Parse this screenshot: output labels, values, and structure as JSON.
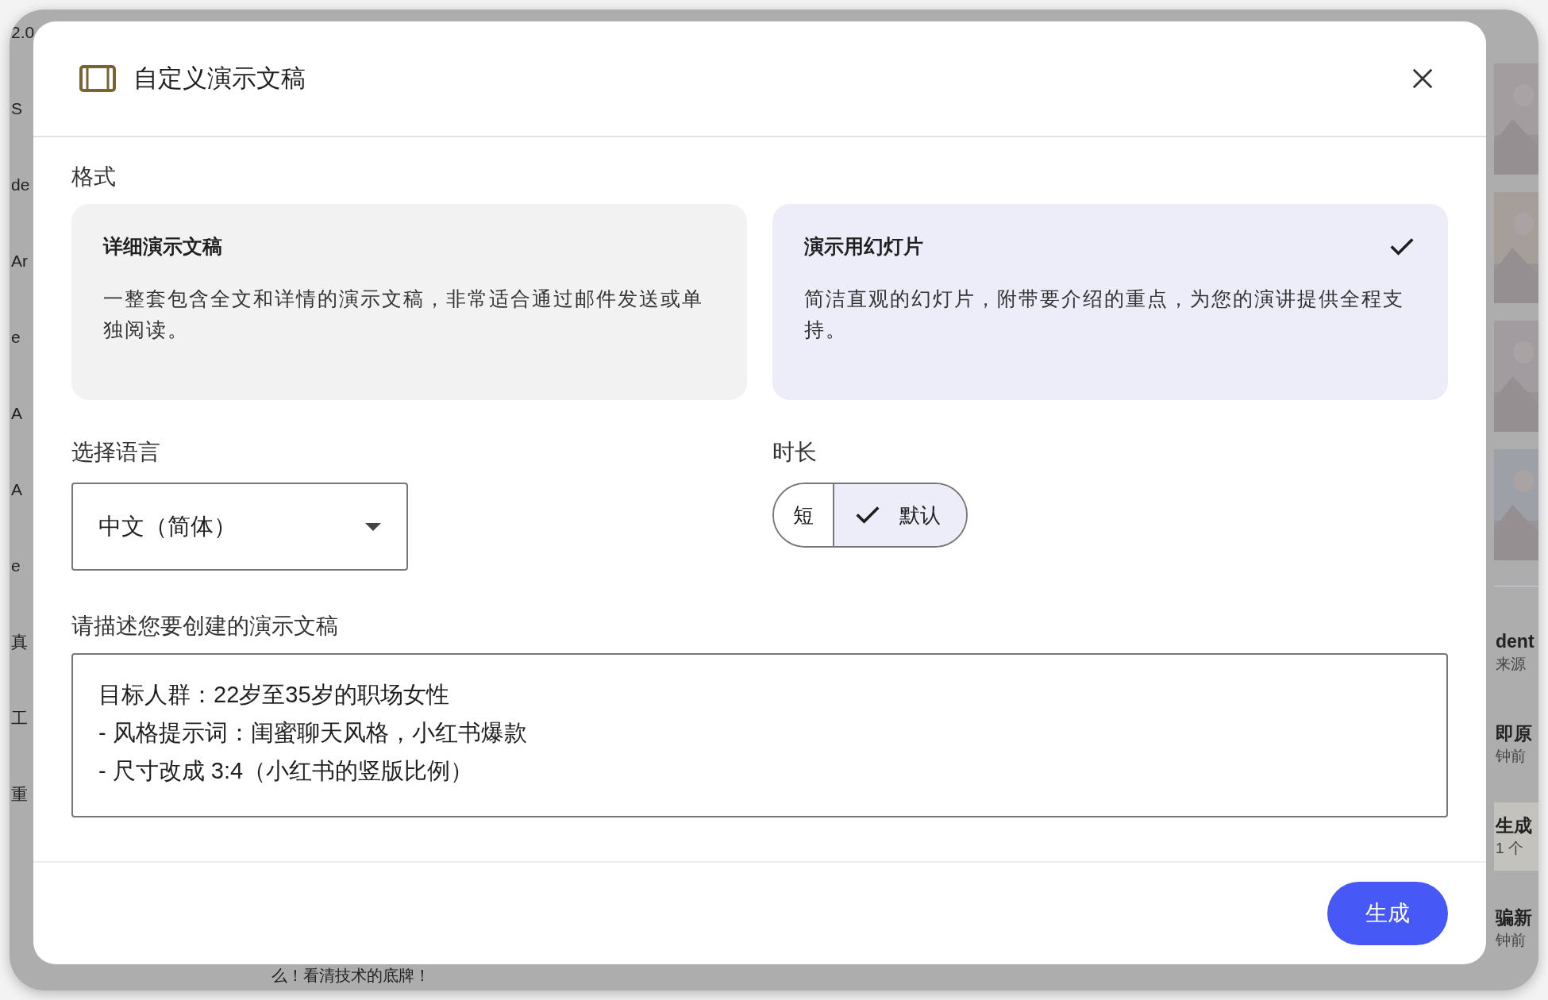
{
  "background": {
    "left_fragments": [
      "2.0",
      "S",
      "de",
      "Ar",
      "e",
      "A",
      "A",
      "e",
      "真",
      "工",
      "重"
    ],
    "right_items": [
      {
        "title": "dent",
        "subtitle": "来源",
        "selected": false
      },
      {
        "title": "即原",
        "subtitle": "钟前",
        "selected": false
      },
      {
        "title": "生成",
        "subtitle": "1 个",
        "selected": true
      },
      {
        "title": "骗新",
        "subtitle": "钟前",
        "selected": false
      }
    ],
    "bottom_text": "么！看清技术的底牌！"
  },
  "dialog": {
    "title": "自定义演示文稿",
    "format": {
      "label": "格式",
      "options": [
        {
          "title": "详细演示文稿",
          "description": "一整套包含全文和详情的演示文稿，非常适合通过邮件发送或单独阅读。",
          "selected": false
        },
        {
          "title": "演示用幻灯片",
          "description": "简洁直观的幻灯片，附带要介绍的重点，为您的演讲提供全程支持。",
          "selected": true
        }
      ]
    },
    "language": {
      "label": "选择语言",
      "value": "中文（简体）"
    },
    "duration": {
      "label": "时长",
      "options": [
        {
          "label": "短",
          "selected": false
        },
        {
          "label": "默认",
          "selected": true
        }
      ]
    },
    "prompt": {
      "label": "请描述您要创建的演示文稿",
      "lines": [
        "目标人群：22岁至35岁的职场女性",
        "- 风格提示词：闺蜜聊天风格，小红书爆款",
        "- 尺寸改成 3:4（小红书的竖版比例）"
      ]
    },
    "buttons": [
      {
        "label": "生成"
      }
    ]
  }
}
